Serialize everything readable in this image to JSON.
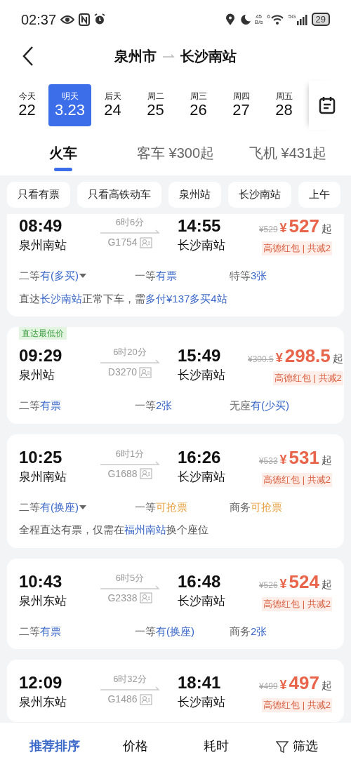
{
  "status_bar": {
    "time": "02:37",
    "net_speed_value": "45",
    "net_speed_unit": "B/s",
    "wifi_badge": "6",
    "signal_badge": "5G",
    "battery": "29"
  },
  "header": {
    "origin": "泉州市",
    "destination": "长沙南站"
  },
  "dates": [
    {
      "weekday": "今天",
      "date": "22",
      "selected": false
    },
    {
      "weekday": "明天",
      "date": "3.23",
      "selected": true
    },
    {
      "weekday": "后天",
      "date": "24",
      "selected": false
    },
    {
      "weekday": "周二",
      "date": "25",
      "selected": false
    },
    {
      "weekday": "周三",
      "date": "26",
      "selected": false
    },
    {
      "weekday": "周四",
      "date": "27",
      "selected": false
    },
    {
      "weekday": "周五",
      "date": "28",
      "selected": false
    }
  ],
  "modes": [
    {
      "label": "火车",
      "selected": true
    },
    {
      "label": "客车 ¥300起",
      "selected": false
    },
    {
      "label": "飞机 ¥431起",
      "selected": false
    }
  ],
  "filters": [
    "只看有票",
    "只看高铁动车",
    "泉州站",
    "长沙南站",
    "上午"
  ],
  "trains": [
    {
      "depart_time": "08:49",
      "depart_station": "泉州南站",
      "duration": "6时6分",
      "train_no": "G1754",
      "arrive_time": "14:55",
      "arrive_station": "长沙南站",
      "original_price": "¥529",
      "currency": "¥",
      "price": "527",
      "price_suffix": "起",
      "promo": "高德红包 | 共减2",
      "seats": [
        {
          "class": "二等",
          "value": "有(多买)",
          "color": "#3a68c9",
          "has_menu": true
        },
        {
          "class": "一等",
          "value": "有票",
          "color": "#3a68c9",
          "has_menu": false
        },
        {
          "class": "特等",
          "value": "3张",
          "color": "#3a68c9",
          "has_menu": false
        }
      ],
      "note": [
        {
          "text": "直达",
          "highlight": false
        },
        {
          "text": "长沙南站",
          "highlight": true
        },
        {
          "text": "正常下车，需",
          "highlight": false
        },
        {
          "text": "多付¥137多买4站",
          "highlight": true
        }
      ]
    },
    {
      "badge": "直达最低价",
      "depart_time": "09:29",
      "depart_station": "泉州站",
      "duration": "6时20分",
      "train_no": "D3270",
      "arrive_time": "15:49",
      "arrive_station": "长沙南站",
      "original_price": "¥300.5",
      "currency": "¥",
      "price": "298.5",
      "price_suffix": "起",
      "promo": "高德红包 | 共减2",
      "seats": [
        {
          "class": "二等",
          "value": "有票",
          "color": "#3a68c9",
          "has_menu": false
        },
        {
          "class": "一等",
          "value": "2张",
          "color": "#3a68c9",
          "has_menu": false
        },
        {
          "class": "无座",
          "value": "有(少买)",
          "color": "#3a68c9",
          "has_menu": false
        }
      ]
    },
    {
      "depart_time": "10:25",
      "depart_station": "泉州南站",
      "duration": "6时1分",
      "train_no": "G1688",
      "arrive_time": "16:26",
      "arrive_station": "长沙南站",
      "original_price": "¥533",
      "currency": "¥",
      "price": "531",
      "price_suffix": "起",
      "promo": "高德红包 | 共减2",
      "seats": [
        {
          "class": "二等",
          "value": "有(换座)",
          "color": "#3a68c9",
          "has_menu": true
        },
        {
          "class": "一等",
          "value": "可抢票",
          "color": "#e8a040",
          "has_menu": false
        },
        {
          "class": "商务",
          "value": "可抢票",
          "color": "#e8a040",
          "has_menu": false
        }
      ],
      "note": [
        {
          "text": "全程直达有票，仅需在",
          "highlight": false
        },
        {
          "text": "福州南站",
          "highlight": true
        },
        {
          "text": "换个座位",
          "highlight": false
        }
      ]
    },
    {
      "depart_time": "10:43",
      "depart_station": "泉州东站",
      "duration": "6时5分",
      "train_no": "G2338",
      "arrive_time": "16:48",
      "arrive_station": "长沙南站",
      "original_price": "¥526",
      "currency": "¥",
      "price": "524",
      "price_suffix": "起",
      "promo": "高德红包 | 共减2",
      "seats": [
        {
          "class": "二等",
          "value": "有票",
          "color": "#3a68c9",
          "has_menu": false
        },
        {
          "class": "一等",
          "value": "有(换座)",
          "color": "#3a68c9",
          "has_menu": false
        },
        {
          "class": "商务",
          "value": "2张",
          "color": "#3a68c9",
          "has_menu": false
        }
      ]
    },
    {
      "depart_time": "12:09",
      "depart_station": "泉州东站",
      "duration": "6时32分",
      "train_no": "G1486",
      "arrive_time": "18:41",
      "arrive_station": "长沙南站",
      "original_price": "¥499",
      "currency": "¥",
      "price": "497",
      "price_suffix": "起",
      "promo": "高德红包 | 共减2"
    }
  ],
  "bottom_bar": [
    {
      "kind": "sort",
      "label": "推荐排序",
      "selected": true
    },
    {
      "kind": "sort",
      "label": "价格",
      "selected": false
    },
    {
      "kind": "sort",
      "label": "耗时",
      "selected": false
    },
    {
      "kind": "filter",
      "label": "筛选",
      "selected": false
    }
  ]
}
